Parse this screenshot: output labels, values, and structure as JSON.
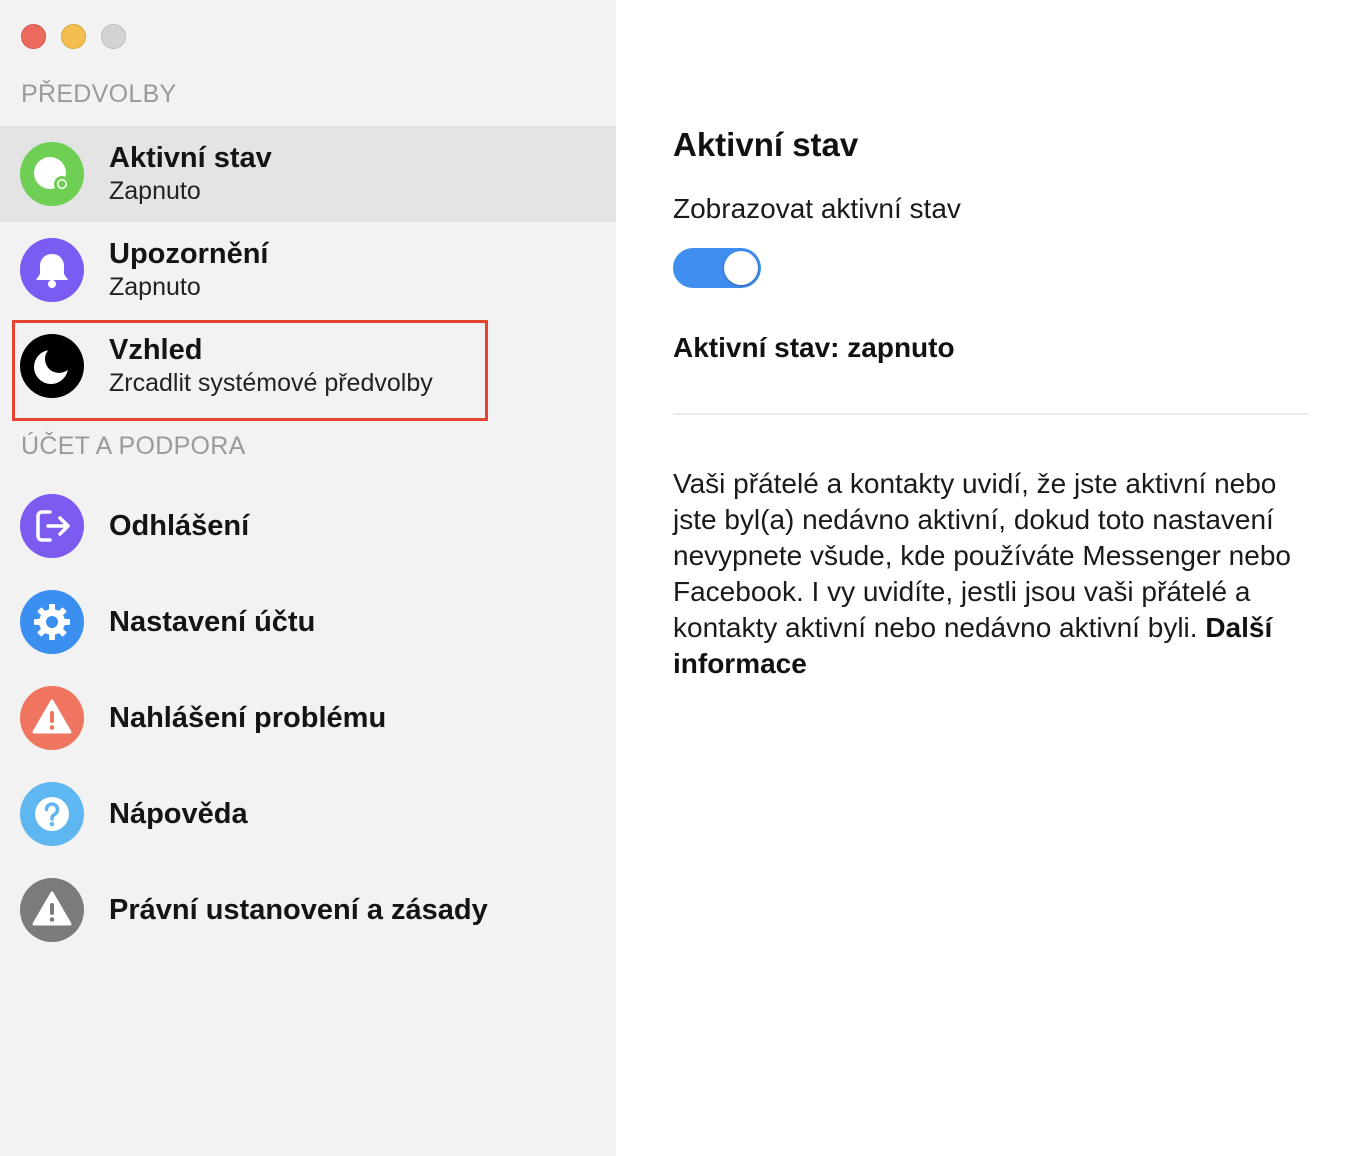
{
  "sidebar": {
    "section_preferences": "PŘEDVOLBY",
    "section_account": "ÚČET A PODPORA",
    "items": [
      {
        "label": "Aktivní stav",
        "sub": "Zapnuto",
        "icon": "active-status-icon",
        "color": "#6fce54"
      },
      {
        "label": "Upozornění",
        "sub": "Zapnuto",
        "icon": "bell-icon",
        "color": "#7a5cf2"
      },
      {
        "label": "Vzhled",
        "sub": "Zrcadlit systémové předvolby",
        "icon": "moon-icon",
        "color": "#000000"
      },
      {
        "label": "Odhlášení",
        "icon": "logout-icon",
        "color": "#7d5bf0"
      },
      {
        "label": "Nastavení účtu",
        "icon": "gear-icon",
        "color": "#3a8ff0"
      },
      {
        "label": "Nahlášení problému",
        "icon": "warning-icon",
        "color": "#ef7560"
      },
      {
        "label": "Nápověda",
        "icon": "help-icon",
        "color": "#5fb7f2"
      },
      {
        "label": "Právní ustanovení a zásady",
        "icon": "legal-warning-icon",
        "color": "#7b7b7b"
      }
    ]
  },
  "content": {
    "title": "Aktivní stav",
    "setting_label": "Zobrazovat aktivní stav",
    "toggle_on": true,
    "status": "Aktivní stav: zapnuto",
    "description": "Vaši přátelé a kontakty uvidí, že jste aktivní nebo jste byl(a) nedávno aktivní, dokud toto nastavení nevypnete všude, kde používáte Messenger nebo Facebook. I vy uvidíte, jestli jsou vaši přátelé a kontakty aktivní nebo nedávno aktivní byli. ",
    "more_link": "Další informace"
  },
  "colors": {
    "accent": "#3f8ef0",
    "highlight": "#e4442d"
  }
}
